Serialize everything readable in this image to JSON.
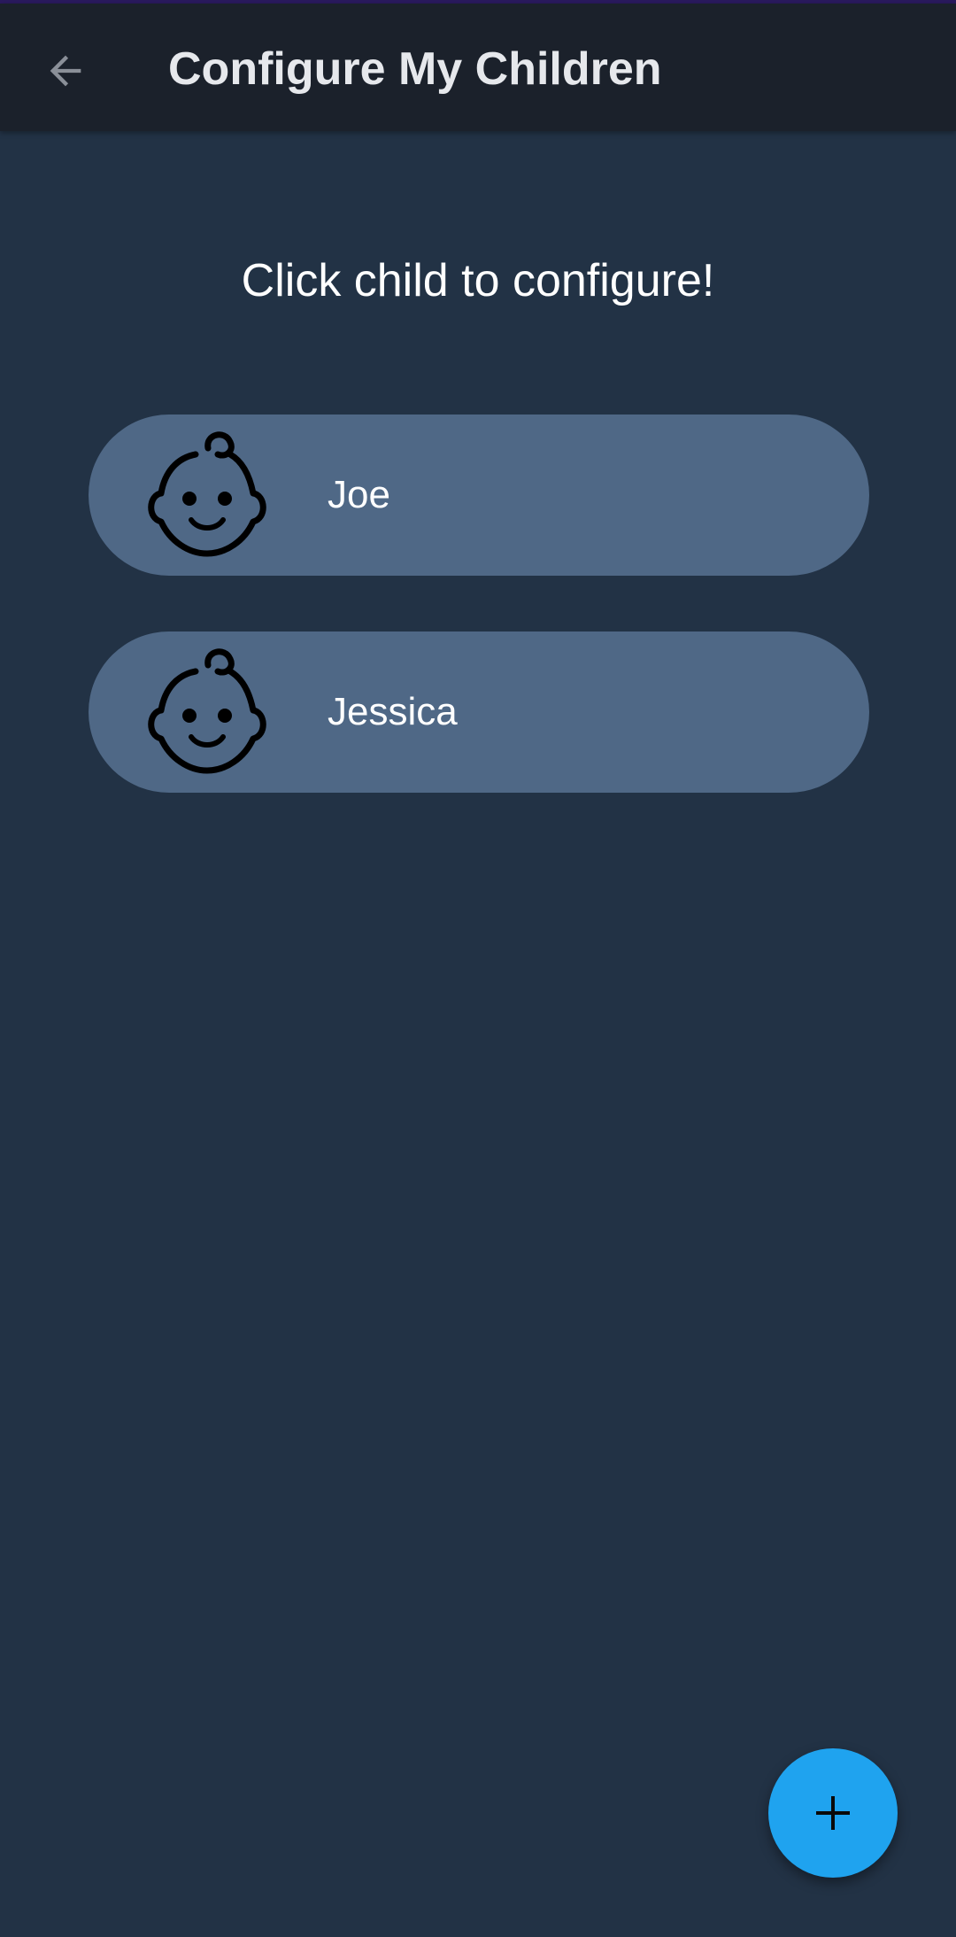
{
  "app_bar": {
    "title": "Configure My Children",
    "back_icon": "arrow-left-icon",
    "background": "#1b212b"
  },
  "main": {
    "instruction": "Click child to configure!",
    "background": "#223245"
  },
  "children": [
    {
      "name": "Joe",
      "icon": "baby-face-icon"
    },
    {
      "name": "Jessica",
      "icon": "baby-face-icon"
    }
  ],
  "fab": {
    "icon": "plus-icon",
    "color": "#1fa3ef"
  },
  "colors": {
    "card": "#4f6886",
    "text": "#ffffff"
  }
}
